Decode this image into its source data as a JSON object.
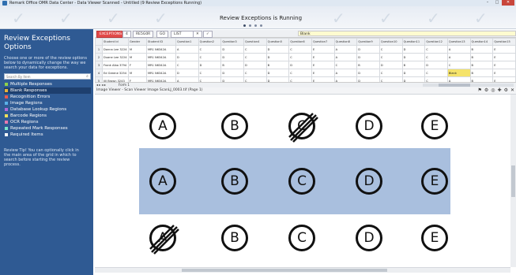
{
  "window": {
    "title": "Remark Office OMR Data Center - Data Viewer Scanned - Untitled (9 Review Exceptions Running)",
    "min": "–",
    "max": "□",
    "close": "✕"
  },
  "header": {
    "banner": "Review Exceptions is Running",
    "watermark": "✓"
  },
  "sidebar": {
    "title": "Review Exceptions Options",
    "description": "Choose one or more of the review options below to dynamically change the way we search your data for exceptions.",
    "search_placeholder": "Search By Item",
    "options": [
      {
        "label": "Multiple Responses",
        "color": "#8fd24a",
        "selected": false
      },
      {
        "label": "Blank Responses",
        "color": "#e8b23a",
        "selected": true
      },
      {
        "label": "Recognition Errors",
        "color": "#e85a4f",
        "selected": false
      },
      {
        "label": "Image Regions",
        "color": "#5ab0e8",
        "selected": false
      },
      {
        "label": "Database Lookup Regions",
        "color": "#b06ad8",
        "selected": false
      },
      {
        "label": "Barcode Regions",
        "color": "#f0e05a",
        "selected": false
      },
      {
        "label": "OCR Regions",
        "color": "#e87ab0",
        "selected": false
      },
      {
        "label": "Repeated Mark Responses",
        "color": "#7ae8c8",
        "selected": false
      },
      {
        "label": "Required Items",
        "color": "#ffffff",
        "selected": false
      }
    ],
    "note": "Review Tip! You can optionally click in the main area of the grid in which to search before starting the review process."
  },
  "toolbar": {
    "exceptions_btn": "EXCEPTIONS",
    "count": "4",
    "nav": "RE5G0R",
    "go": "GO",
    "field": "LIST",
    "cancel": "✕",
    "ok": "✓",
    "formula": "Blank"
  },
  "grid": {
    "headers": [
      "",
      "Student Id",
      "Gender",
      "Student ID",
      "Question1",
      "Question2",
      "Question3",
      "Question4",
      "Question5",
      "Question6",
      "Question7",
      "Question8",
      "Question9",
      "Question10",
      "Question11",
      "Question12",
      "Question13",
      "Question14",
      "Question15"
    ],
    "rows": [
      [
        "1",
        "Donna Lee 3224",
        "M",
        "MR1 N6342A",
        "A",
        "C",
        "D",
        "C",
        "D",
        "C",
        "E",
        "A",
        "D",
        "C",
        "D",
        "C",
        "A",
        "B",
        "E"
      ],
      [
        "2",
        "Duane Lee 3224",
        "M",
        "MR1 N6342A",
        "D",
        "C",
        "D",
        "C",
        "D",
        "C",
        "E",
        "A",
        "D",
        "C",
        "D",
        "C",
        "A",
        "B",
        "E"
      ],
      [
        "3",
        "Frank Alba 3794",
        "F",
        "MR1 N6342A",
        "C",
        "D",
        "B",
        "D",
        "B",
        "D",
        "E",
        "C",
        "B",
        "D",
        "B",
        "D",
        "C",
        "B",
        "E"
      ],
      [
        "4",
        "Ed Greene 3254",
        "M",
        "MR1 N6342A",
        "D",
        "C",
        "D",
        "C",
        "D",
        "C",
        "E",
        "A",
        "D",
        "C",
        "D",
        "C",
        "Blank",
        "B",
        "E"
      ],
      [
        "5",
        "Jill Brown 3243",
        "F",
        "MR1 N6342A",
        "A",
        "C",
        "D",
        "C",
        "D",
        "C",
        "E",
        "A",
        "D",
        "C",
        "D",
        "C",
        "A",
        "B",
        "E"
      ]
    ],
    "sheet_name": "Form 1"
  },
  "image": {
    "path": "Image Viewer - Scan Viewer Image ScanLJ_0003.tif (Page 1)",
    "tools": [
      "⚑",
      "⚙",
      "◎",
      "✚",
      "⚙",
      "✕"
    ]
  },
  "bubbles": {
    "row1": [
      "A",
      "B",
      "C",
      "D",
      "E"
    ],
    "row2": [
      "A",
      "B",
      "C",
      "D",
      "E"
    ],
    "row3": [
      "A",
      "B",
      "C",
      "D",
      "E"
    ]
  }
}
